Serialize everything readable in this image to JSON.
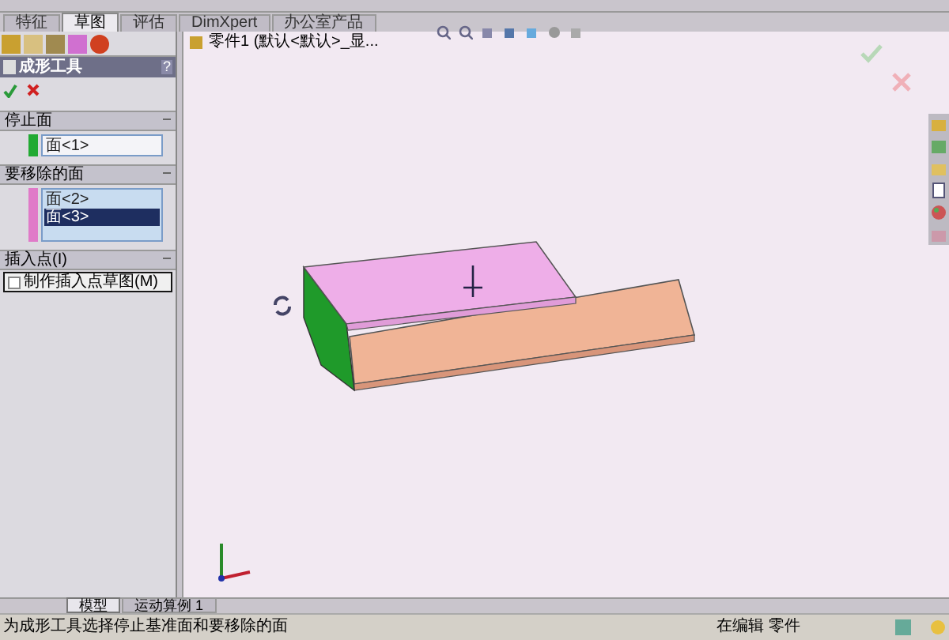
{
  "tabs": [
    {
      "label": "特征",
      "selected": false
    },
    {
      "label": "草图",
      "selected": true
    },
    {
      "label": "评估",
      "selected": false
    },
    {
      "label": "DimXpert",
      "selected": false
    },
    {
      "label": "办公室产品",
      "selected": false
    }
  ],
  "panel": {
    "title": "成形工具",
    "help": "?",
    "sections": [
      {
        "kind": "list",
        "title": "停止面",
        "color": "#22aa33",
        "items": [
          {
            "label": "面<1>",
            "selected": false
          }
        ]
      },
      {
        "kind": "list",
        "title": "要移除的面",
        "color": "#e07ac8",
        "items": [
          {
            "label": "面<2>",
            "selected": false
          },
          {
            "label": "面<3>",
            "selected": true
          }
        ]
      },
      {
        "kind": "checkbox",
        "title": "插入点(I)",
        "option": {
          "label": "制作插入点草图(M)",
          "checked": false
        }
      }
    ]
  },
  "tree": {
    "label": "零件1 (默认<默认>_显..."
  },
  "bottom_tabs": [
    {
      "label": "模型",
      "selected": true
    },
    {
      "label": "运动算例 1",
      "selected": false
    }
  ],
  "status_bar": {
    "message": "为成形工具选择停止基准面和要移除的面",
    "mode": "在编辑 零件"
  }
}
